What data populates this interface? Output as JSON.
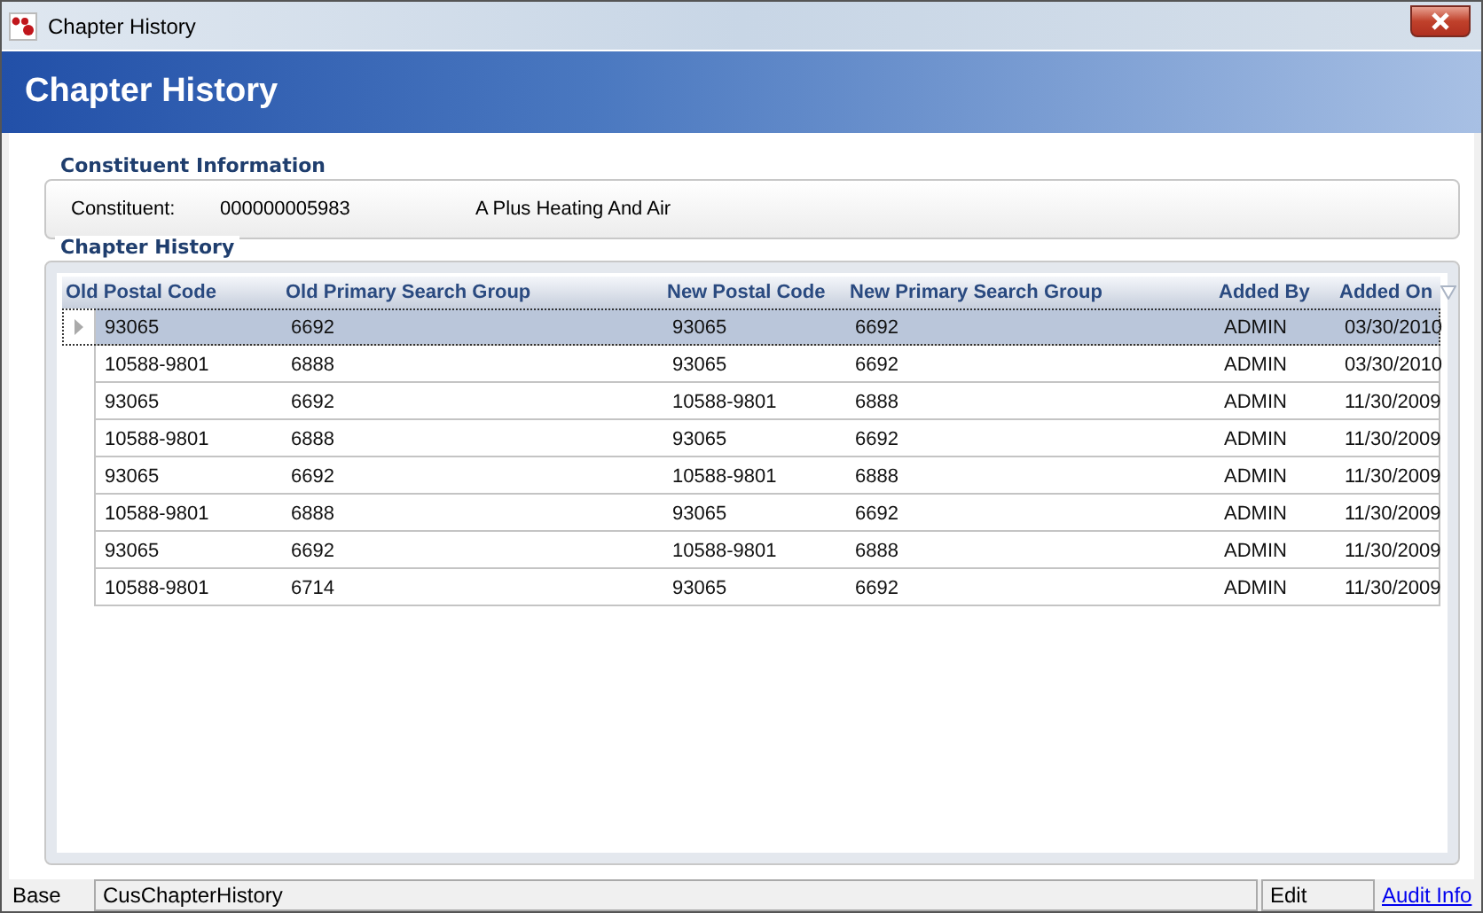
{
  "window": {
    "title": "Chapter History"
  },
  "header": {
    "title": "Chapter History"
  },
  "constituent_information": {
    "legend": "Constituent Information",
    "label": "Constituent:",
    "id": "000000005983",
    "name": "A Plus Heating And Air"
  },
  "chapter_history": {
    "legend": "Chapter History",
    "columns": [
      {
        "label": "Old Postal Code",
        "sorted": false
      },
      {
        "label": "Old Primary Search Group",
        "sorted": false
      },
      {
        "label": "New Postal Code",
        "sorted": false
      },
      {
        "label": "New Primary Search Group",
        "sorted": false
      },
      {
        "label": "Added By",
        "sorted": false
      },
      {
        "label": "Added On",
        "sorted": true
      }
    ],
    "rows": [
      {
        "selected": true,
        "cells": [
          "93065",
          "6692",
          "93065",
          "6692",
          "ADMIN",
          "03/30/2010"
        ]
      },
      {
        "selected": false,
        "cells": [
          "10588-9801",
          "6888",
          "93065",
          "6692",
          "ADMIN",
          "03/30/2010"
        ]
      },
      {
        "selected": false,
        "cells": [
          "93065",
          "6692",
          "10588-9801",
          "6888",
          "ADMIN",
          "11/30/2009"
        ]
      },
      {
        "selected": false,
        "cells": [
          "10588-9801",
          "6888",
          "93065",
          "6692",
          "ADMIN",
          "11/30/2009"
        ]
      },
      {
        "selected": false,
        "cells": [
          "93065",
          "6692",
          "10588-9801",
          "6888",
          "ADMIN",
          "11/30/2009"
        ]
      },
      {
        "selected": false,
        "cells": [
          "10588-9801",
          "6888",
          "93065",
          "6692",
          "ADMIN",
          "11/30/2009"
        ]
      },
      {
        "selected": false,
        "cells": [
          "93065",
          "6692",
          "10588-9801",
          "6888",
          "ADMIN",
          "11/30/2009"
        ]
      },
      {
        "selected": false,
        "cells": [
          "10588-9801",
          "6714",
          "93065",
          "6692",
          "ADMIN",
          "11/30/2009"
        ]
      }
    ]
  },
  "status_bar": {
    "mode": "Base",
    "form": "CusChapterHistory",
    "state": "Edit",
    "link": "Audit Info"
  }
}
